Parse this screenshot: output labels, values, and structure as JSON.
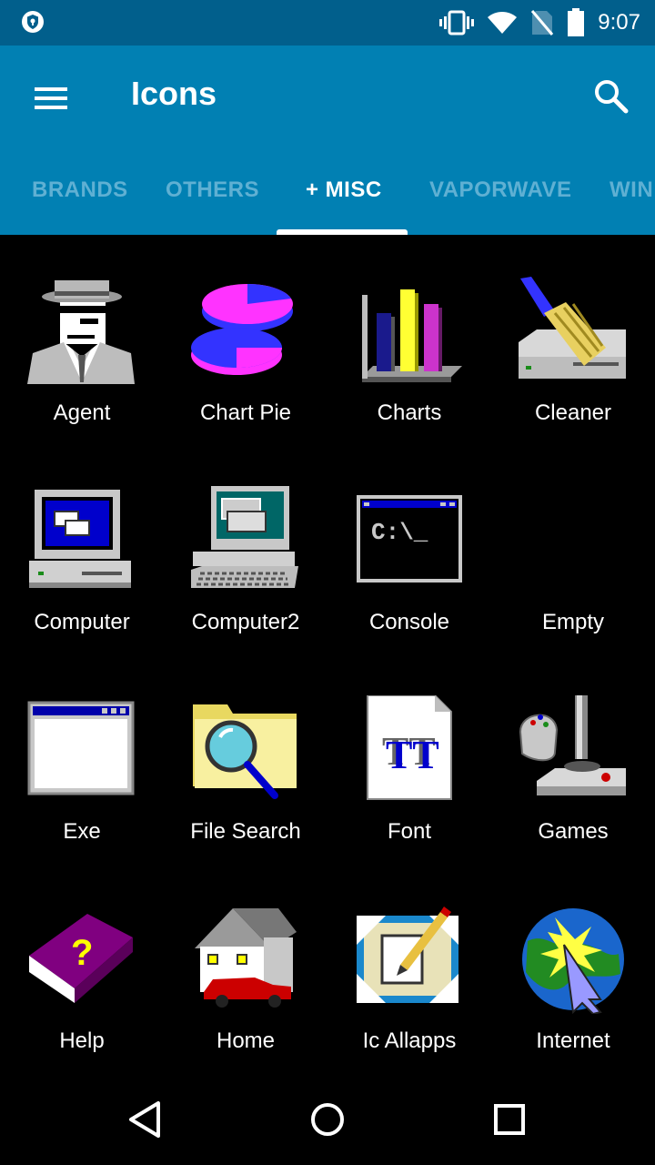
{
  "status": {
    "time": "9:07",
    "left_icon": "vpn-shield-icon",
    "icons": [
      "vibrate-icon",
      "wifi-icon",
      "no-sim-icon",
      "battery-icon"
    ]
  },
  "appbar": {
    "title": "Icons",
    "menu_icon": "hamburger-menu-icon",
    "search_icon": "search-icon"
  },
  "tabs": [
    {
      "label": "BRANDS",
      "active": false
    },
    {
      "label": "OTHERS",
      "active": false
    },
    {
      "label": "+ MISC",
      "active": true
    },
    {
      "label": "VAPORWAVE",
      "active": false
    },
    {
      "label": "WIN",
      "active": false
    }
  ],
  "icons": [
    {
      "label": "Agent",
      "icon": "agent-icon"
    },
    {
      "label": "Chart Pie",
      "icon": "chart-pie-icon"
    },
    {
      "label": "Charts",
      "icon": "charts-icon"
    },
    {
      "label": "Cleaner",
      "icon": "cleaner-icon"
    },
    {
      "label": "Computer",
      "icon": "computer-icon"
    },
    {
      "label": "Computer2",
      "icon": "computer2-icon"
    },
    {
      "label": "Console",
      "icon": "console-icon"
    },
    {
      "label": "Empty",
      "icon": "empty-icon"
    },
    {
      "label": "Exe",
      "icon": "exe-icon"
    },
    {
      "label": "File Search",
      "icon": "file-search-icon"
    },
    {
      "label": "Font",
      "icon": "font-icon"
    },
    {
      "label": "Games",
      "icon": "games-icon"
    },
    {
      "label": "Help",
      "icon": "help-icon"
    },
    {
      "label": "Home",
      "icon": "home-icon"
    },
    {
      "label": "Ic Allapps",
      "icon": "ic-allapps-icon"
    },
    {
      "label": "Internet",
      "icon": "internet-icon"
    }
  ],
  "icon_text": {
    "console": "C:\\_",
    "font": "TT",
    "help": "?"
  },
  "colors": {
    "status_bar": "#015f8c",
    "app_bar": "#0180b3",
    "tab_inactive": "#5fb0d3",
    "background": "#000000"
  },
  "navbar": {
    "back_icon": "back-triangle-icon",
    "home_icon": "home-circle-icon",
    "recents_icon": "recents-square-icon"
  }
}
